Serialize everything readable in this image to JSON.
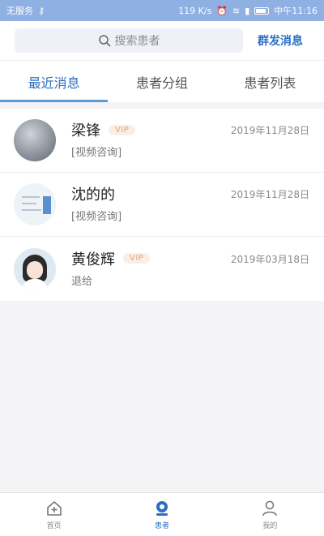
{
  "status_bar": {
    "carrier": "无服务",
    "speed": "119 K/s",
    "time": "中午11:16"
  },
  "header": {
    "search_placeholder": "搜索患者",
    "broadcast_label": "群发消息"
  },
  "tabs": [
    {
      "label": "最近消息",
      "active": true
    },
    {
      "label": "患者分组",
      "active": false
    },
    {
      "label": "患者列表",
      "active": false
    }
  ],
  "messages": [
    {
      "name": "梁锋",
      "vip": "VIP",
      "date": "2019年11月28日",
      "preview": "[视频咨询]",
      "avatar": "sky-photo-avatar"
    },
    {
      "name": "沈的的",
      "vip": "",
      "date": "2019年11月28日",
      "preview": "[视频咨询]",
      "avatar": "document-avatar"
    },
    {
      "name": "黄俊辉",
      "vip": "VIP",
      "date": "2019年03月18日",
      "preview": "退给",
      "avatar": "girl-avatar"
    }
  ],
  "bottom_nav": [
    {
      "label": "首页",
      "icon": "home-plus-icon",
      "active": false
    },
    {
      "label": "患者",
      "icon": "patient-icon",
      "active": true
    },
    {
      "label": "我的",
      "icon": "person-icon",
      "active": false
    }
  ],
  "colors": {
    "status_bar": "#8fb0e2",
    "accent": "#2a6fc4",
    "tab_indicator": "#5b9bd5",
    "vip_text": "#e9a07a",
    "vip_bg": "#fbeee4"
  }
}
